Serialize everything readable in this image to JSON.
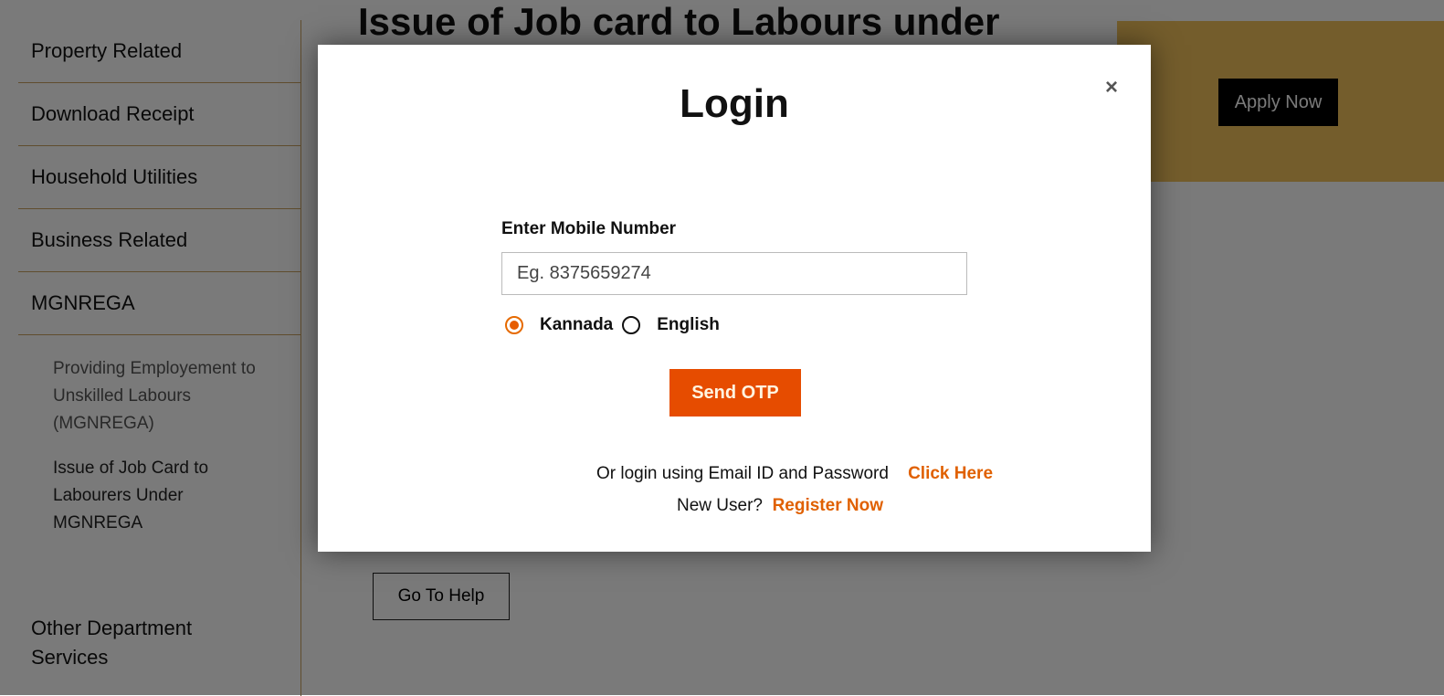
{
  "sidebar": {
    "items": [
      {
        "label": "Property Related"
      },
      {
        "label": "Download Receipt"
      },
      {
        "label": "Household Utilities"
      },
      {
        "label": "Business Related"
      },
      {
        "label": "MGNREGA"
      }
    ],
    "sub_items": [
      {
        "label": "Providing Employement to Unskilled Labours (MGNREGA)"
      },
      {
        "label": "Issue of Job Card to Labourers Under MGNREGA"
      }
    ],
    "other": "Other Department Services"
  },
  "main": {
    "heading": "Issue of Job card to Labours under",
    "apply_label": "Apply Now",
    "help_label": "Go To Help"
  },
  "modal": {
    "title": "Login",
    "close": "×",
    "mobile_label": "Enter Mobile Number",
    "mobile_placeholder": "Eg. 8375659274",
    "mobile_value": "",
    "languages": [
      {
        "label": "Kannada",
        "selected": true
      },
      {
        "label": "English",
        "selected": false
      }
    ],
    "send_otp": "Send OTP",
    "alt_text": "Or login using Email ID and Password",
    "alt_link": "Click Here",
    "new_user": "New User?",
    "register": "Register Now"
  },
  "colors": {
    "accent": "#e64c00",
    "link": "#e06000",
    "gold": "#f2c25c"
  }
}
